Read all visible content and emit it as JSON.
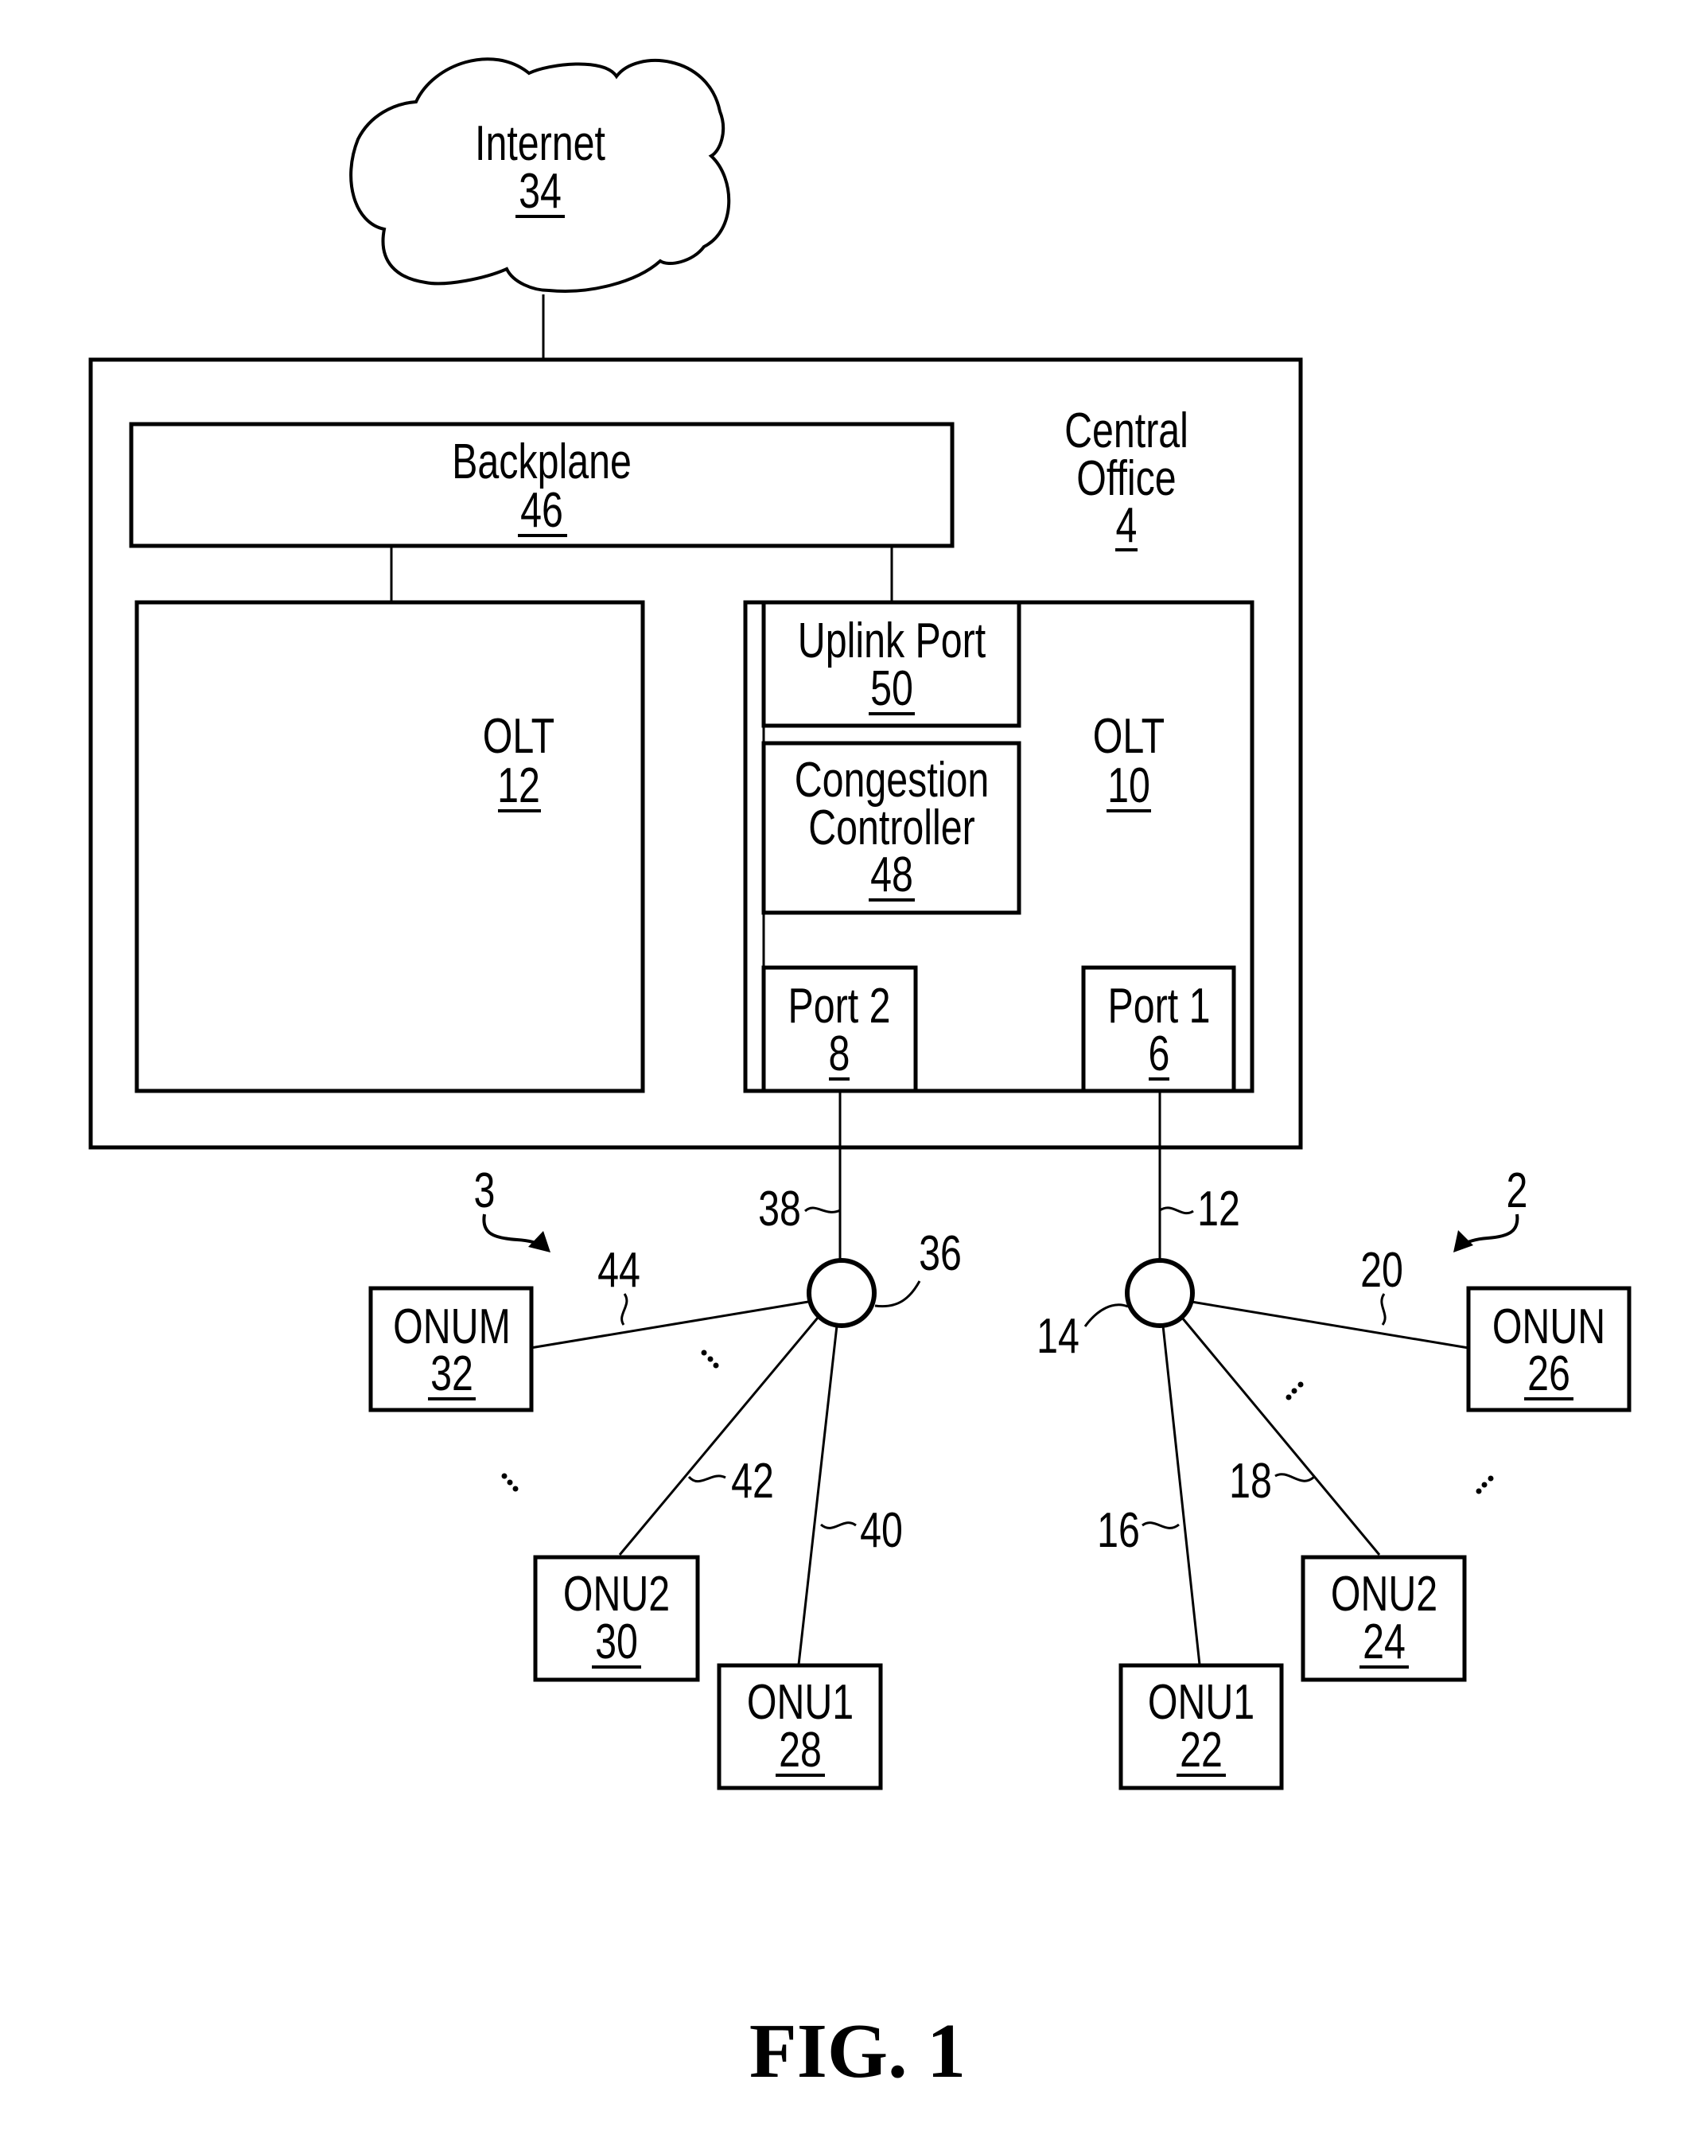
{
  "figure": {
    "caption": "FIG. 1",
    "internet": {
      "label": "Internet",
      "ref": "34"
    },
    "central_office": {
      "label_line1": "Central",
      "label_line2": "Office",
      "ref": "4"
    },
    "backplane": {
      "label": "Backplane",
      "ref": "46"
    },
    "olt_a": {
      "label": "OLT",
      "ref": "12"
    },
    "olt_b": {
      "label": "OLT",
      "ref": "10"
    },
    "uplink_port": {
      "label": "Uplink Port",
      "ref": "50"
    },
    "congestion_controller": {
      "label_line1": "Congestion",
      "label_line2": "Controller",
      "ref": "48"
    },
    "port_2": {
      "label": "Port 2",
      "ref": "8"
    },
    "port_1": {
      "label": "Port 1",
      "ref": "6"
    },
    "network_3": {
      "ref": "3"
    },
    "network_2": {
      "ref": "2"
    },
    "splitter_left": {
      "ref": "36",
      "feeder_ref": "38"
    },
    "splitter_right": {
      "ref": "14",
      "feeder_ref": "12"
    },
    "onus_left": [
      {
        "label": "ONUM",
        "ref": "32",
        "link_ref": "44"
      },
      {
        "label": "ONU2",
        "ref": "30",
        "link_ref": "42"
      },
      {
        "label": "ONU1",
        "ref": "28",
        "link_ref": "40"
      }
    ],
    "onus_right": [
      {
        "label": "ONU1",
        "ref": "22",
        "link_ref": "16"
      },
      {
        "label": "ONU2",
        "ref": "24",
        "link_ref": "18"
      },
      {
        "label": "ONUN",
        "ref": "26",
        "link_ref": "20"
      }
    ]
  }
}
